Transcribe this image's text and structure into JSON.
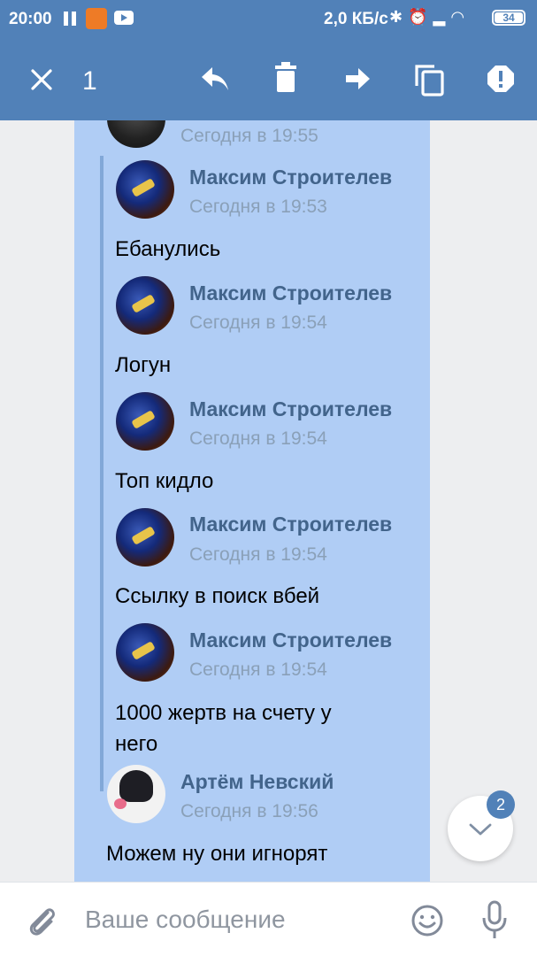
{
  "status": {
    "time": "20:00",
    "speed": "2,0 КБ/с",
    "battery": "34"
  },
  "action_bar": {
    "selected_count": "1"
  },
  "messages": [
    {
      "name": "",
      "time": "Сегодня в 19:55",
      "text": ""
    },
    {
      "name": "Максим Строителев",
      "time": "Сегодня в 19:53",
      "text": "Ебанулись"
    },
    {
      "name": "Максим Строителев",
      "time": "Сегодня в 19:54",
      "text": "Логун"
    },
    {
      "name": "Максим Строителев",
      "time": "Сегодня в 19:54",
      "text": "Топ кидло"
    },
    {
      "name": "Максим Строителев",
      "time": "Сегодня в 19:54",
      "text": "Ссылку в поиск вбей"
    },
    {
      "name": "Максим Строителев",
      "time": "Сегодня в 19:54",
      "text_line1": "1000 жертв на счету у",
      "text_line2": "него"
    },
    {
      "name": "Артём Невский",
      "time": "Сегодня в 19:56",
      "text": "Можем ну они игнорят"
    }
  ],
  "scroll_down": {
    "badge": "2"
  },
  "composer": {
    "placeholder": "Ваше сообщение"
  },
  "colors": {
    "header": "#5181b8",
    "selection": "#b0cdf5",
    "name": "#42648b"
  }
}
